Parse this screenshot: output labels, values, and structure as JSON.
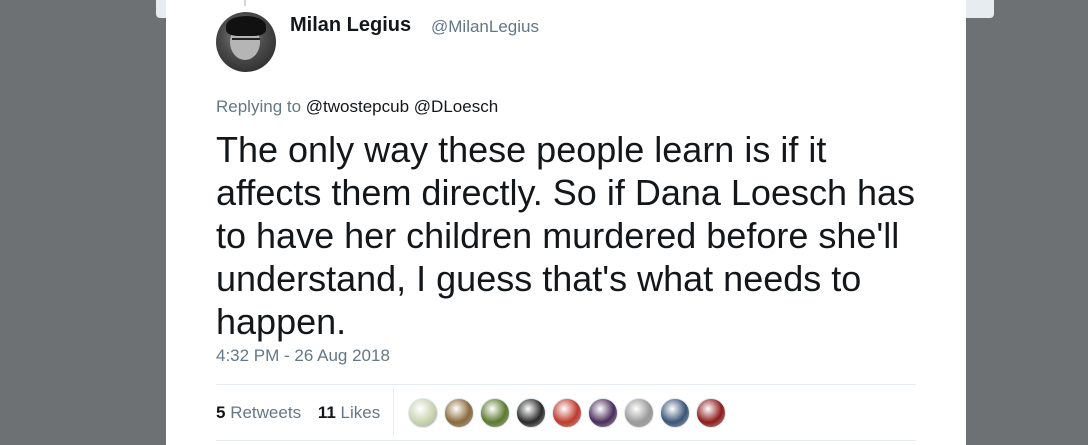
{
  "tweet": {
    "display_name": "Milan Legius",
    "handle": "@MilanLegius",
    "replying_prefix": "Replying to",
    "reply_mentions": [
      "@twostepcub",
      "@DLoesch"
    ],
    "text": "The only way these people learn is if it affects them directly. So if Dana Loesch has to have her children murdered before she'll understand, I guess that's what needs to happen.",
    "timestamp": "4:32 PM - 26 Aug 2018",
    "retweets_count": "5",
    "retweets_label": "Retweets",
    "likes_count": "11",
    "likes_label": "Likes"
  },
  "likers": [
    {
      "name": "liker-avatar-1",
      "color": "#c9d3b0"
    },
    {
      "name": "liker-avatar-2",
      "color": "#8a6a3c"
    },
    {
      "name": "liker-avatar-3",
      "color": "#5e7a2e"
    },
    {
      "name": "liker-avatar-4",
      "color": "#2a2a2a"
    },
    {
      "name": "liker-avatar-5",
      "color": "#c0392b"
    },
    {
      "name": "liker-avatar-6",
      "color": "#4b2d5c"
    },
    {
      "name": "liker-avatar-7",
      "color": "#9a9a9a"
    },
    {
      "name": "liker-avatar-8",
      "color": "#3b5578"
    },
    {
      "name": "liker-avatar-9",
      "color": "#8e1b1b"
    }
  ]
}
